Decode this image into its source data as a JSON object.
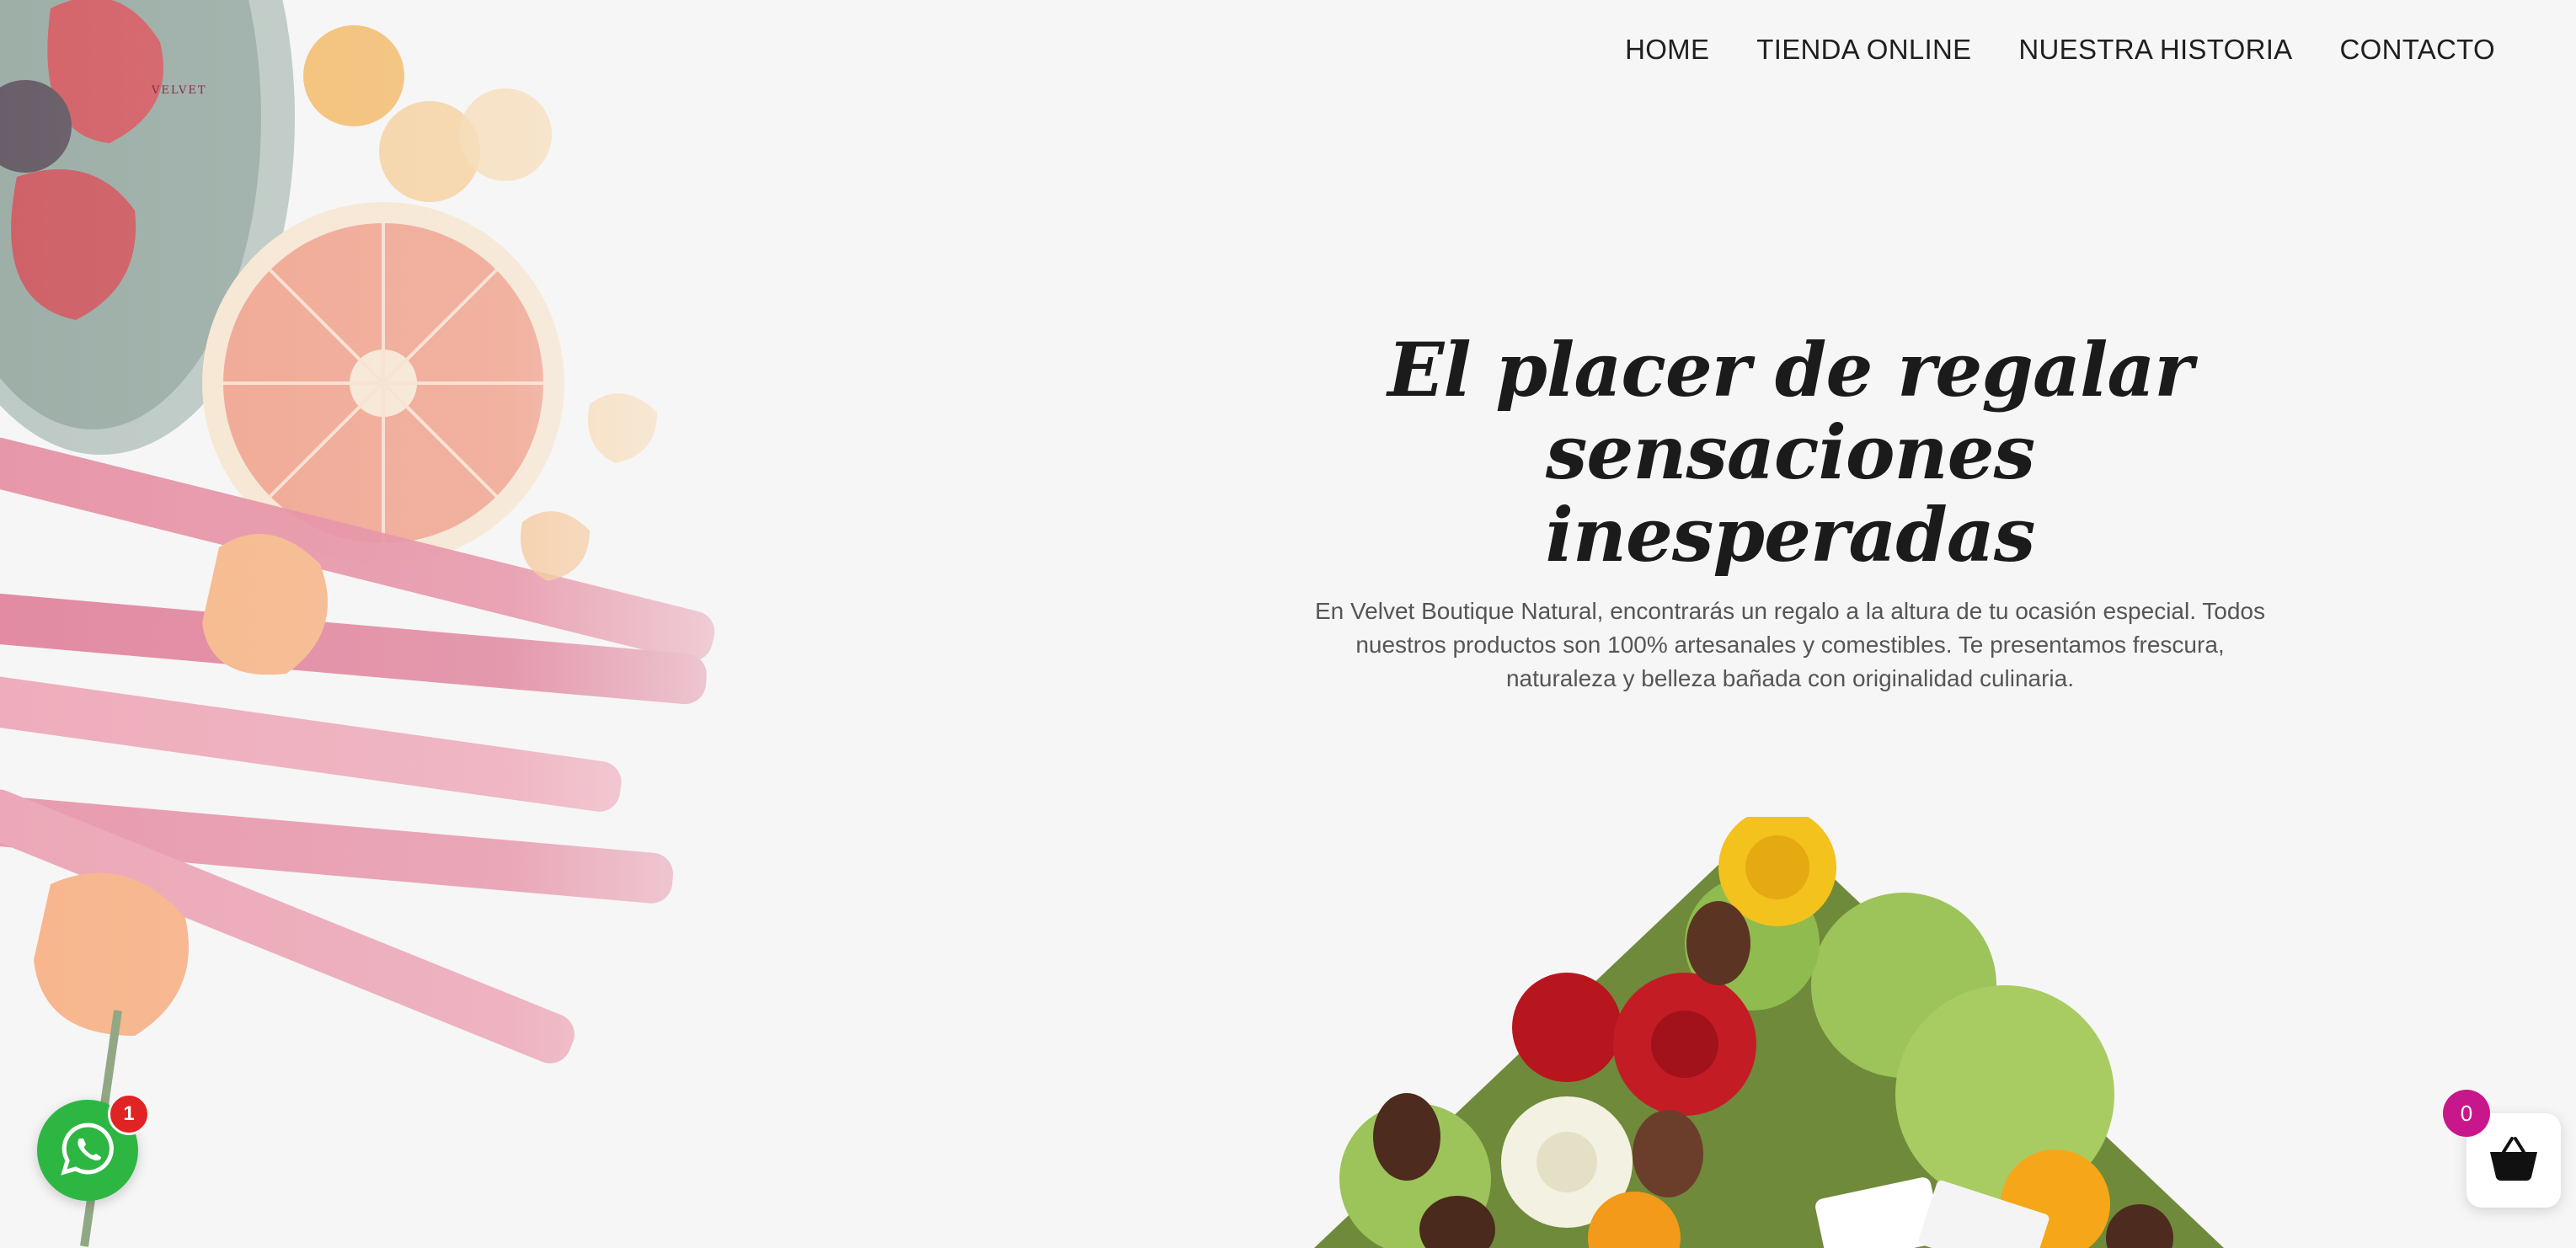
{
  "brand": {
    "logo_text": "VELVET"
  },
  "nav": {
    "items": [
      {
        "label": "HOME"
      },
      {
        "label": "TIENDA ONLINE"
      },
      {
        "label": "NUESTRA HISTORIA"
      },
      {
        "label": "CONTACTO"
      }
    ]
  },
  "hero": {
    "title": "El placer de regalar sensaciones inesperadas",
    "description": "En Velvet Boutique Natural, encontrarás un regalo a la altura de tu ocasión especial. Todos nuestros productos son 100% artesanales y comestibles. Te presentamos frescura, naturaleza y belleza bañada con originalidad culinaria."
  },
  "whatsapp": {
    "icon": "whatsapp-icon",
    "badge_count": "1",
    "color": "#2db742"
  },
  "cart": {
    "icon": "basket-icon",
    "count": "0",
    "badge_color": "#c8178a"
  }
}
